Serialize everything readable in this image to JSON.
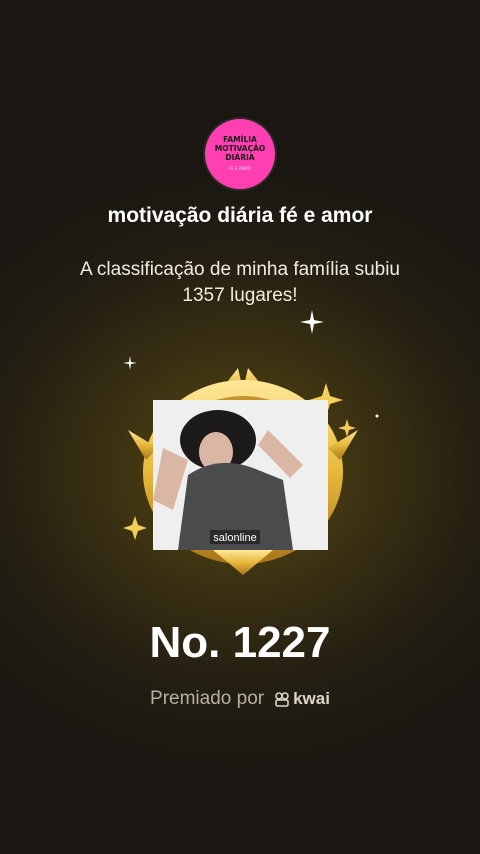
{
  "family": {
    "logo_lines": [
      "FAMÍLIA",
      "MOTIVAÇÃO",
      "DIÁRIA"
    ],
    "logo_small": "FÉ E AMOR",
    "name": "motivação diária fé e amor"
  },
  "message": "A classificação de minha família subiu 1357 lugares!",
  "medal": {
    "sticker_text": "salonline"
  },
  "rank": "No. 1227",
  "footer": {
    "awarded_by": "Premiado por",
    "brand": "kwai"
  },
  "colors": {
    "logo_bg": "#ff3fb2",
    "gold": "#e7b83b"
  }
}
